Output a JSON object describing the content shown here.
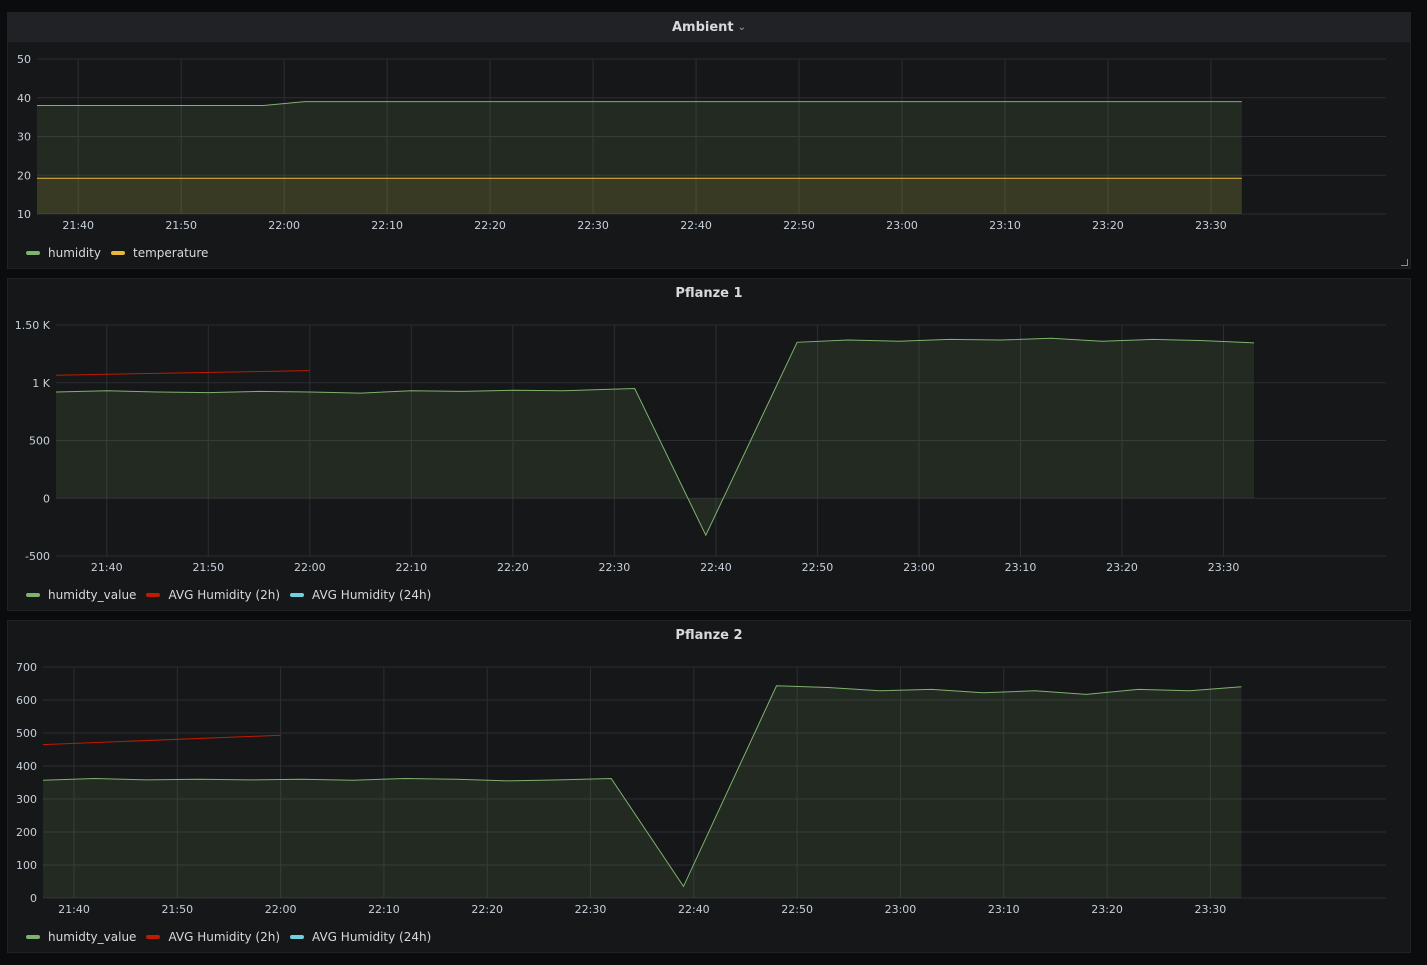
{
  "panels": [
    {
      "title": "Ambient",
      "has_menu": true,
      "legend": [
        {
          "name": "humidity",
          "color": "#7eb26d"
        },
        {
          "name": "temperature",
          "color": "#eab839"
        }
      ]
    },
    {
      "title": "Pflanze 1",
      "has_menu": false,
      "legend": [
        {
          "name": "humidty_value",
          "color": "#7eb26d"
        },
        {
          "name": "AVG Humidity (2h)",
          "color": "#bf1b00"
        },
        {
          "name": "AVG Humidity (24h)",
          "color": "#6ed0e0"
        }
      ]
    },
    {
      "title": "Pflanze 2",
      "has_menu": false,
      "legend": [
        {
          "name": "humidty_value",
          "color": "#7eb26d"
        },
        {
          "name": "AVG Humidity (2h)",
          "color": "#bf1b00"
        },
        {
          "name": "AVG Humidity (24h)",
          "color": "#6ed0e0"
        }
      ]
    }
  ],
  "chart_data": [
    {
      "type": "area",
      "x_domain": [
        "21:36",
        "23:47"
      ],
      "x_ticks": [
        "21:40",
        "21:50",
        "22:00",
        "22:10",
        "22:20",
        "22:30",
        "22:40",
        "22:50",
        "23:00",
        "23:10",
        "23:20",
        "23:30"
      ],
      "y_ticks": [
        {
          "v": 10,
          "l": "10"
        },
        {
          "v": 20,
          "l": "20"
        },
        {
          "v": 30,
          "l": "30"
        },
        {
          "v": 40,
          "l": "40"
        },
        {
          "v": 50,
          "l": "50"
        }
      ],
      "ylim": [
        10,
        50
      ],
      "grid": true,
      "legend_position": "bottom-left",
      "series": [
        {
          "name": "humidity",
          "color": "#7eb26d",
          "fill": true,
          "x": [
            "21:36",
            "21:58",
            "22:02",
            "23:33"
          ],
          "y": [
            38,
            38,
            39,
            39
          ]
        },
        {
          "name": "temperature",
          "color": "#eab839",
          "fill": true,
          "x": [
            "21:36",
            "23:33"
          ],
          "y": [
            19.2,
            19.2
          ]
        }
      ]
    },
    {
      "type": "area",
      "x_domain": [
        "21:35",
        "23:46"
      ],
      "x_ticks": [
        "21:40",
        "21:50",
        "22:00",
        "22:10",
        "22:20",
        "22:30",
        "22:40",
        "22:50",
        "23:00",
        "23:10",
        "23:20",
        "23:30"
      ],
      "y_ticks": [
        {
          "v": -500,
          "l": "-500"
        },
        {
          "v": 0,
          "l": "0"
        },
        {
          "v": 500,
          "l": "500"
        },
        {
          "v": 1000,
          "l": "1 K"
        },
        {
          "v": 1500,
          "l": "1.50 K"
        }
      ],
      "ylim": [
        -500,
        1500
      ],
      "grid": true,
      "legend_position": "bottom-left",
      "series": [
        {
          "name": "humidty_value",
          "color": "#7eb26d",
          "fill": true,
          "x": [
            "21:35",
            "21:40",
            "21:45",
            "21:50",
            "21:55",
            "22:00",
            "22:05",
            "22:10",
            "22:15",
            "22:20",
            "22:25",
            "22:30",
            "22:32",
            "22:39",
            "22:48",
            "22:53",
            "22:58",
            "23:03",
            "23:08",
            "23:13",
            "23:18",
            "23:23",
            "23:28",
            "23:33"
          ],
          "y": [
            920,
            930,
            920,
            915,
            925,
            920,
            910,
            930,
            925,
            935,
            930,
            945,
            950,
            -320,
            1350,
            1370,
            1360,
            1375,
            1370,
            1385,
            1360,
            1375,
            1365,
            1345
          ]
        },
        {
          "name": "AVG Humidity (2h)",
          "color": "#bf1b00",
          "fill": false,
          "x": [
            "21:35",
            "22:00"
          ],
          "y": [
            1065,
            1105
          ]
        }
      ]
    },
    {
      "type": "area",
      "x_domain": [
        "21:37",
        "23:47"
      ],
      "x_ticks": [
        "21:40",
        "21:50",
        "22:00",
        "22:10",
        "22:20",
        "22:30",
        "22:40",
        "22:50",
        "23:00",
        "23:10",
        "23:20",
        "23:30"
      ],
      "y_ticks": [
        {
          "v": 0,
          "l": "0"
        },
        {
          "v": 100,
          "l": "100"
        },
        {
          "v": 200,
          "l": "200"
        },
        {
          "v": 300,
          "l": "300"
        },
        {
          "v": 400,
          "l": "400"
        },
        {
          "v": 500,
          "l": "500"
        },
        {
          "v": 600,
          "l": "600"
        },
        {
          "v": 700,
          "l": "700"
        }
      ],
      "ylim": [
        0,
        700
      ],
      "grid": true,
      "legend_position": "bottom-left",
      "series": [
        {
          "name": "humidty_value",
          "color": "#7eb26d",
          "fill": true,
          "x": [
            "21:37",
            "21:42",
            "21:47",
            "21:52",
            "21:57",
            "22:02",
            "22:07",
            "22:12",
            "22:17",
            "22:22",
            "22:27",
            "22:32",
            "22:39",
            "22:48",
            "22:53",
            "22:58",
            "23:03",
            "23:08",
            "23:13",
            "23:18",
            "23:23",
            "23:28",
            "23:33"
          ],
          "y": [
            357,
            362,
            358,
            360,
            358,
            360,
            357,
            362,
            360,
            355,
            358,
            362,
            35,
            643,
            638,
            628,
            632,
            622,
            628,
            617,
            632,
            628,
            640
          ]
        },
        {
          "name": "AVG Humidity (2h)",
          "color": "#bf1b00",
          "fill": false,
          "x": [
            "21:37",
            "22:00"
          ],
          "y": [
            465,
            493
          ]
        }
      ]
    }
  ]
}
